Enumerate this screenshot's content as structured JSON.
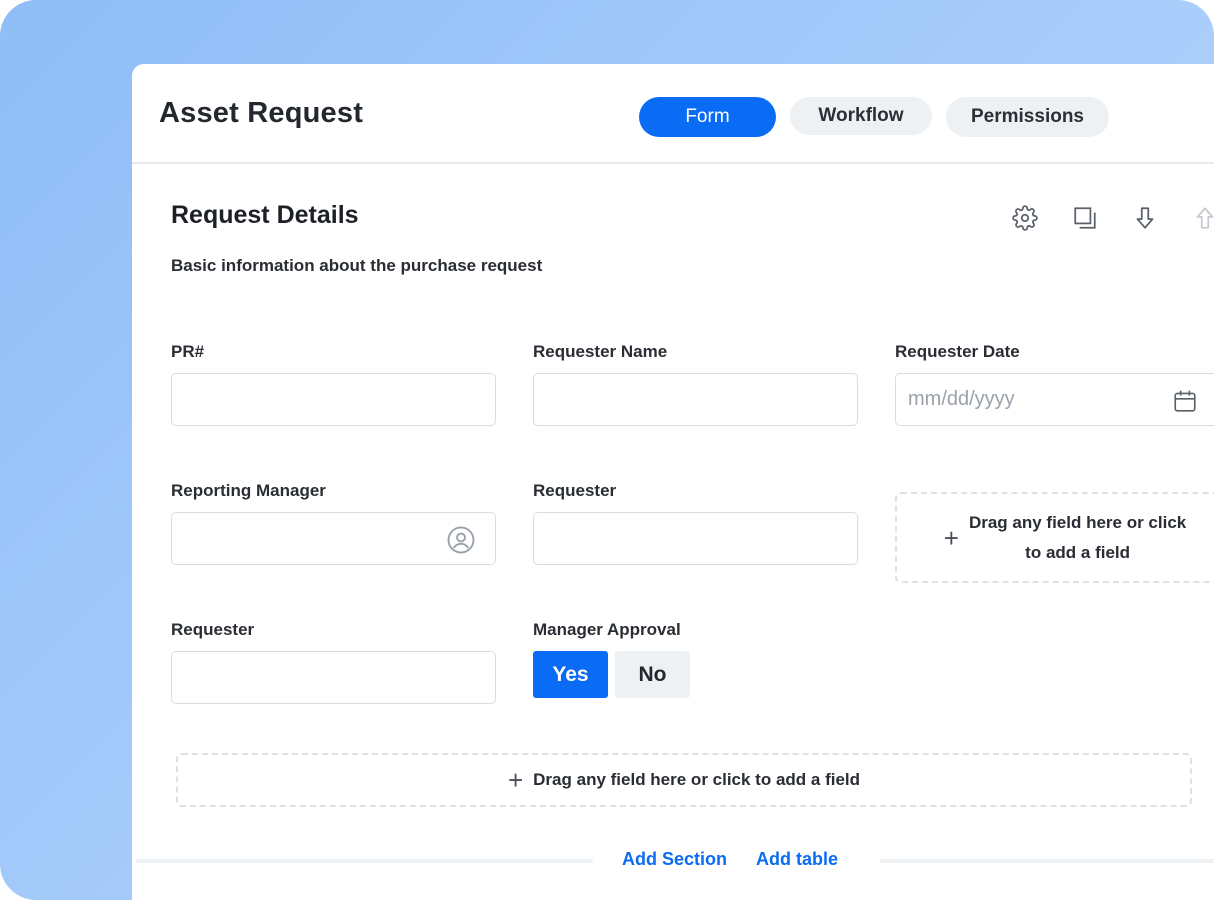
{
  "app": {
    "title": "Asset Request"
  },
  "tabs": [
    {
      "label": "Form",
      "active": true
    },
    {
      "label": "Workflow",
      "active": false
    },
    {
      "label": "Permissions",
      "active": false
    }
  ],
  "section": {
    "title": "Request Details",
    "description": "Basic information about the purchase request",
    "tools": [
      "gear-icon",
      "duplicate-icon",
      "arrow-down-icon",
      "arrow-up-icon"
    ]
  },
  "fields": {
    "pr_number": {
      "label": "PR#",
      "value": ""
    },
    "requester_name": {
      "label": "Requester Name",
      "value": ""
    },
    "requester_date": {
      "label": "Requester Date",
      "placeholder": "mm/dd/yyyy",
      "icon": "calendar-icon"
    },
    "reporting_manager": {
      "label": "Reporting Manager",
      "value": "",
      "icon": "user-icon"
    },
    "requester_1": {
      "label": "Requester",
      "value": ""
    },
    "requester_2": {
      "label": "Requester",
      "value": ""
    },
    "manager_approval": {
      "label": "Manager Approval",
      "options": [
        "Yes",
        "No"
      ],
      "selected": "Yes"
    }
  },
  "dropzones": {
    "cell": {
      "line1": "Drag any field here or click",
      "line2": "to add a field"
    },
    "row": {
      "text": "Drag any field here or click to add a field"
    }
  },
  "footer": {
    "add_section": "Add Section",
    "add_table": "Add table"
  },
  "colors": {
    "accent": "#0a6cf5",
    "muted_bg": "#eef1f4",
    "border": "#d8dde3"
  }
}
